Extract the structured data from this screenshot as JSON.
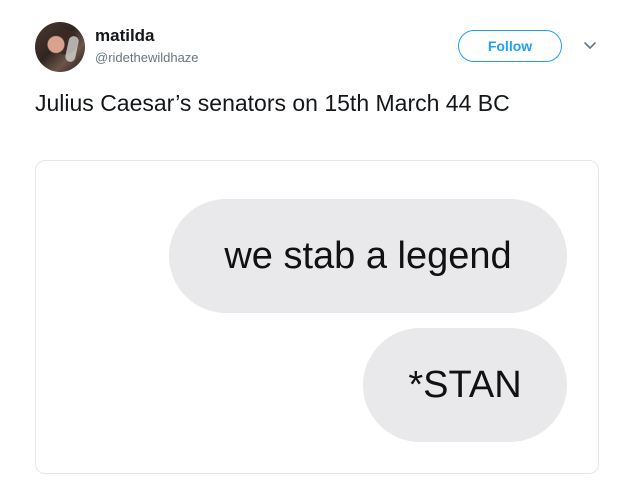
{
  "user": {
    "name": "matilda",
    "handle": "@ridethewildhaze"
  },
  "actions": {
    "follow_label": "Follow"
  },
  "icons": {
    "menu": "chevron-down-icon",
    "avatar": "profile-photo"
  },
  "tweet": {
    "text": "Julius Caesar’s senators on 15th March 44 BC"
  },
  "media": {
    "messages": [
      {
        "text": "we stab a legend"
      },
      {
        "text": "*STAN"
      }
    ]
  },
  "colors": {
    "accent": "#1da1f2",
    "handle": "#657786",
    "bubble": "#e9e9eb",
    "card_border": "#e1e8ed"
  }
}
